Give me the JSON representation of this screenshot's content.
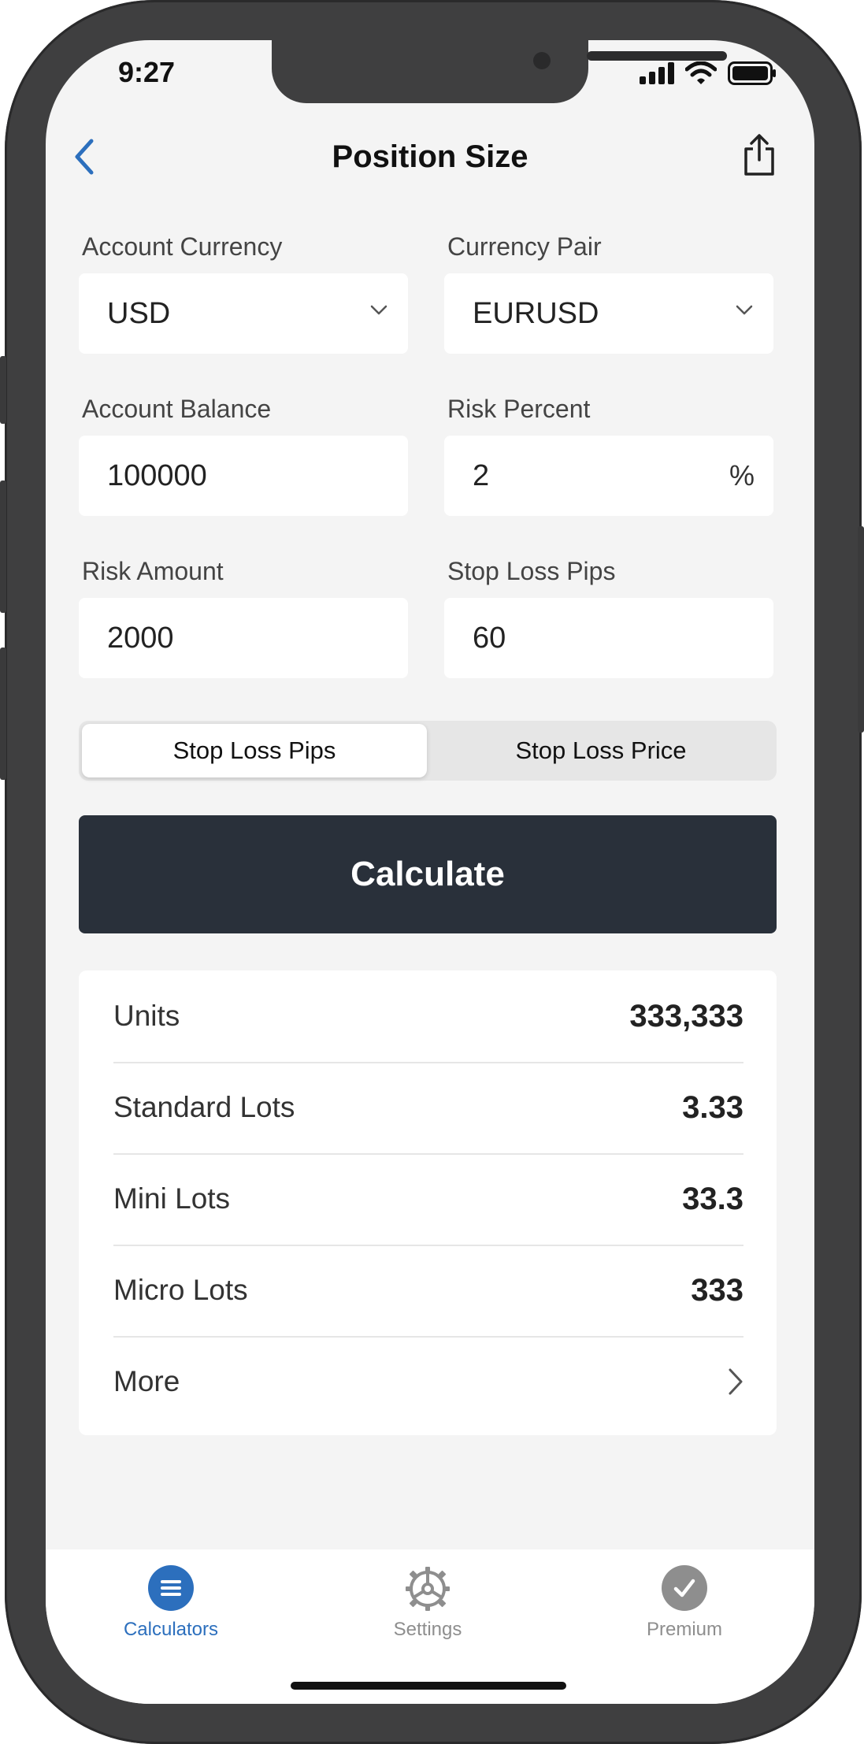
{
  "status_bar": {
    "time": "9:27"
  },
  "nav": {
    "title": "Position Size",
    "back_icon": "chevron-left-icon",
    "share_icon": "share-icon"
  },
  "form": {
    "account_currency": {
      "label": "Account Currency",
      "value": "USD"
    },
    "currency_pair": {
      "label": "Currency Pair",
      "value": "EURUSD"
    },
    "account_balance": {
      "label": "Account Balance",
      "value": "100000"
    },
    "risk_percent": {
      "label": "Risk Percent",
      "value": "2",
      "suffix": "%"
    },
    "risk_amount": {
      "label": "Risk Amount",
      "value": "2000"
    },
    "stop_loss_pips": {
      "label": "Stop Loss Pips",
      "value": "60"
    }
  },
  "segmented": {
    "options": [
      "Stop Loss Pips",
      "Stop Loss Price"
    ],
    "selected": "Stop Loss Pips"
  },
  "calculate_label": "Calculate",
  "results": [
    {
      "label": "Units",
      "value": "333,333"
    },
    {
      "label": "Standard Lots",
      "value": "3.33"
    },
    {
      "label": "Mini Lots",
      "value": "33.3"
    },
    {
      "label": "Micro Lots",
      "value": "333"
    }
  ],
  "more_label": "More",
  "tabs": [
    {
      "label": "Calculators",
      "icon": "list-icon",
      "active": true
    },
    {
      "label": "Settings",
      "icon": "gear-icon",
      "active": false
    },
    {
      "label": "Premium",
      "icon": "checkmark-icon",
      "active": false
    }
  ],
  "colors": {
    "accent": "#2c6fbd",
    "button_dark": "#29303a",
    "tab_inactive": "#8e8e8e",
    "background": "#f4f4f4"
  }
}
